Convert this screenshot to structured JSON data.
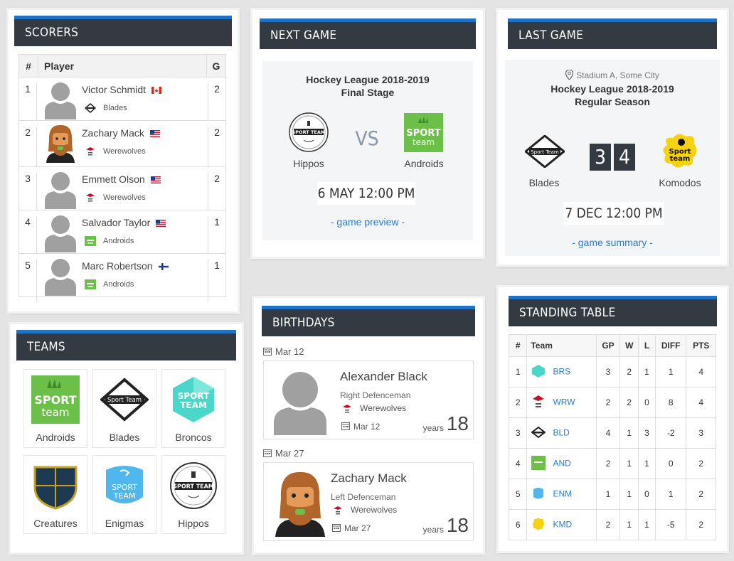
{
  "scorers": {
    "title": "SCORERS",
    "headers": {
      "num": "#",
      "player": "Player",
      "goals": "G"
    },
    "rows": [
      {
        "num": "1",
        "name": "Victor Schmidt",
        "team": "Blades",
        "goals": "2",
        "flag": "canada-flag-icon",
        "avatar": "placeholder"
      },
      {
        "num": "2",
        "name": "Zachary Mack",
        "team": "Werewolves",
        "goals": "2",
        "flag": "usa-flag-icon",
        "avatar": "bearded"
      },
      {
        "num": "3",
        "name": "Emmett Olson",
        "team": "Werewolves",
        "goals": "2",
        "flag": "usa-flag-icon",
        "avatar": "placeholder"
      },
      {
        "num": "4",
        "name": "Salvador Taylor",
        "team": "Androids",
        "goals": "1",
        "flag": "usa-flag-icon",
        "avatar": "placeholder"
      },
      {
        "num": "5",
        "name": "Marc Robertson",
        "team": "Androids",
        "goals": "1",
        "flag": "finland-flag-icon",
        "avatar": "placeholder"
      }
    ]
  },
  "next_game": {
    "title": "NEXT GAME",
    "league": "Hockey League 2018-2019",
    "stage": "Final Stage",
    "home": "Hippos",
    "away": "Androids",
    "vs": "VS",
    "datetime": "6 MAY 12:00 PM",
    "link": "- game preview -"
  },
  "last_game": {
    "title": "LAST GAME",
    "venue": "Stadium A, Some City",
    "league": "Hockey League 2018-2019",
    "stage": "Regular Season",
    "home": "Blades",
    "away": "Komodos",
    "home_score": "3",
    "away_score": "4",
    "datetime": "7 DEC 12:00 PM",
    "link": "- game summary -"
  },
  "teams": {
    "title": "TEAMS",
    "items": [
      "Androids",
      "Blades",
      "Broncos",
      "Creatures",
      "Enigmas",
      "Hippos"
    ],
    "logo_texts": {
      "sport": "SPORT",
      "team": "team",
      "sport_team": "Sport Team",
      "SPORT_TEAM": "SPORT TEAM"
    }
  },
  "birthdays": {
    "title": "BIRTHDAYS",
    "entries": [
      {
        "date_label": "Mar 12",
        "name": "Alexander Black",
        "position": "Right Defenceman",
        "team": "Werewolves",
        "date": "Mar 12",
        "years_label": "years",
        "age": "18"
      },
      {
        "date_label": "Mar 27",
        "name": "Zachary Mack",
        "position": "Left Defenceman",
        "team": "Werewolves",
        "date": "Mar 27",
        "years_label": "years",
        "age": "18"
      }
    ]
  },
  "standing": {
    "title": "STANDING TABLE",
    "headers": [
      "#",
      "Team",
      "GP",
      "W",
      "L",
      "DIFF",
      "PTS"
    ],
    "rows": [
      {
        "pos": "1",
        "team": "BRS",
        "gp": "3",
        "w": "2",
        "l": "1",
        "diff": "1",
        "pts": "4"
      },
      {
        "pos": "2",
        "team": "WRW",
        "gp": "2",
        "w": "2",
        "l": "0",
        "diff": "8",
        "pts": "4"
      },
      {
        "pos": "3",
        "team": "BLD",
        "gp": "4",
        "w": "1",
        "l": "3",
        "diff": "-2",
        "pts": "3"
      },
      {
        "pos": "4",
        "team": "AND",
        "gp": "2",
        "w": "1",
        "l": "1",
        "diff": "0",
        "pts": "2"
      },
      {
        "pos": "5",
        "team": "ENM",
        "gp": "1",
        "w": "1",
        "l": "0",
        "diff": "1",
        "pts": "2"
      },
      {
        "pos": "6",
        "team": "KMD",
        "gp": "2",
        "w": "1",
        "l": "1",
        "diff": "-5",
        "pts": "2"
      }
    ]
  },
  "colors": {
    "accent": "#1f72c6",
    "header_bg": "#343a42",
    "android_green": "#6cc04a",
    "link": "#2a7bd0"
  }
}
